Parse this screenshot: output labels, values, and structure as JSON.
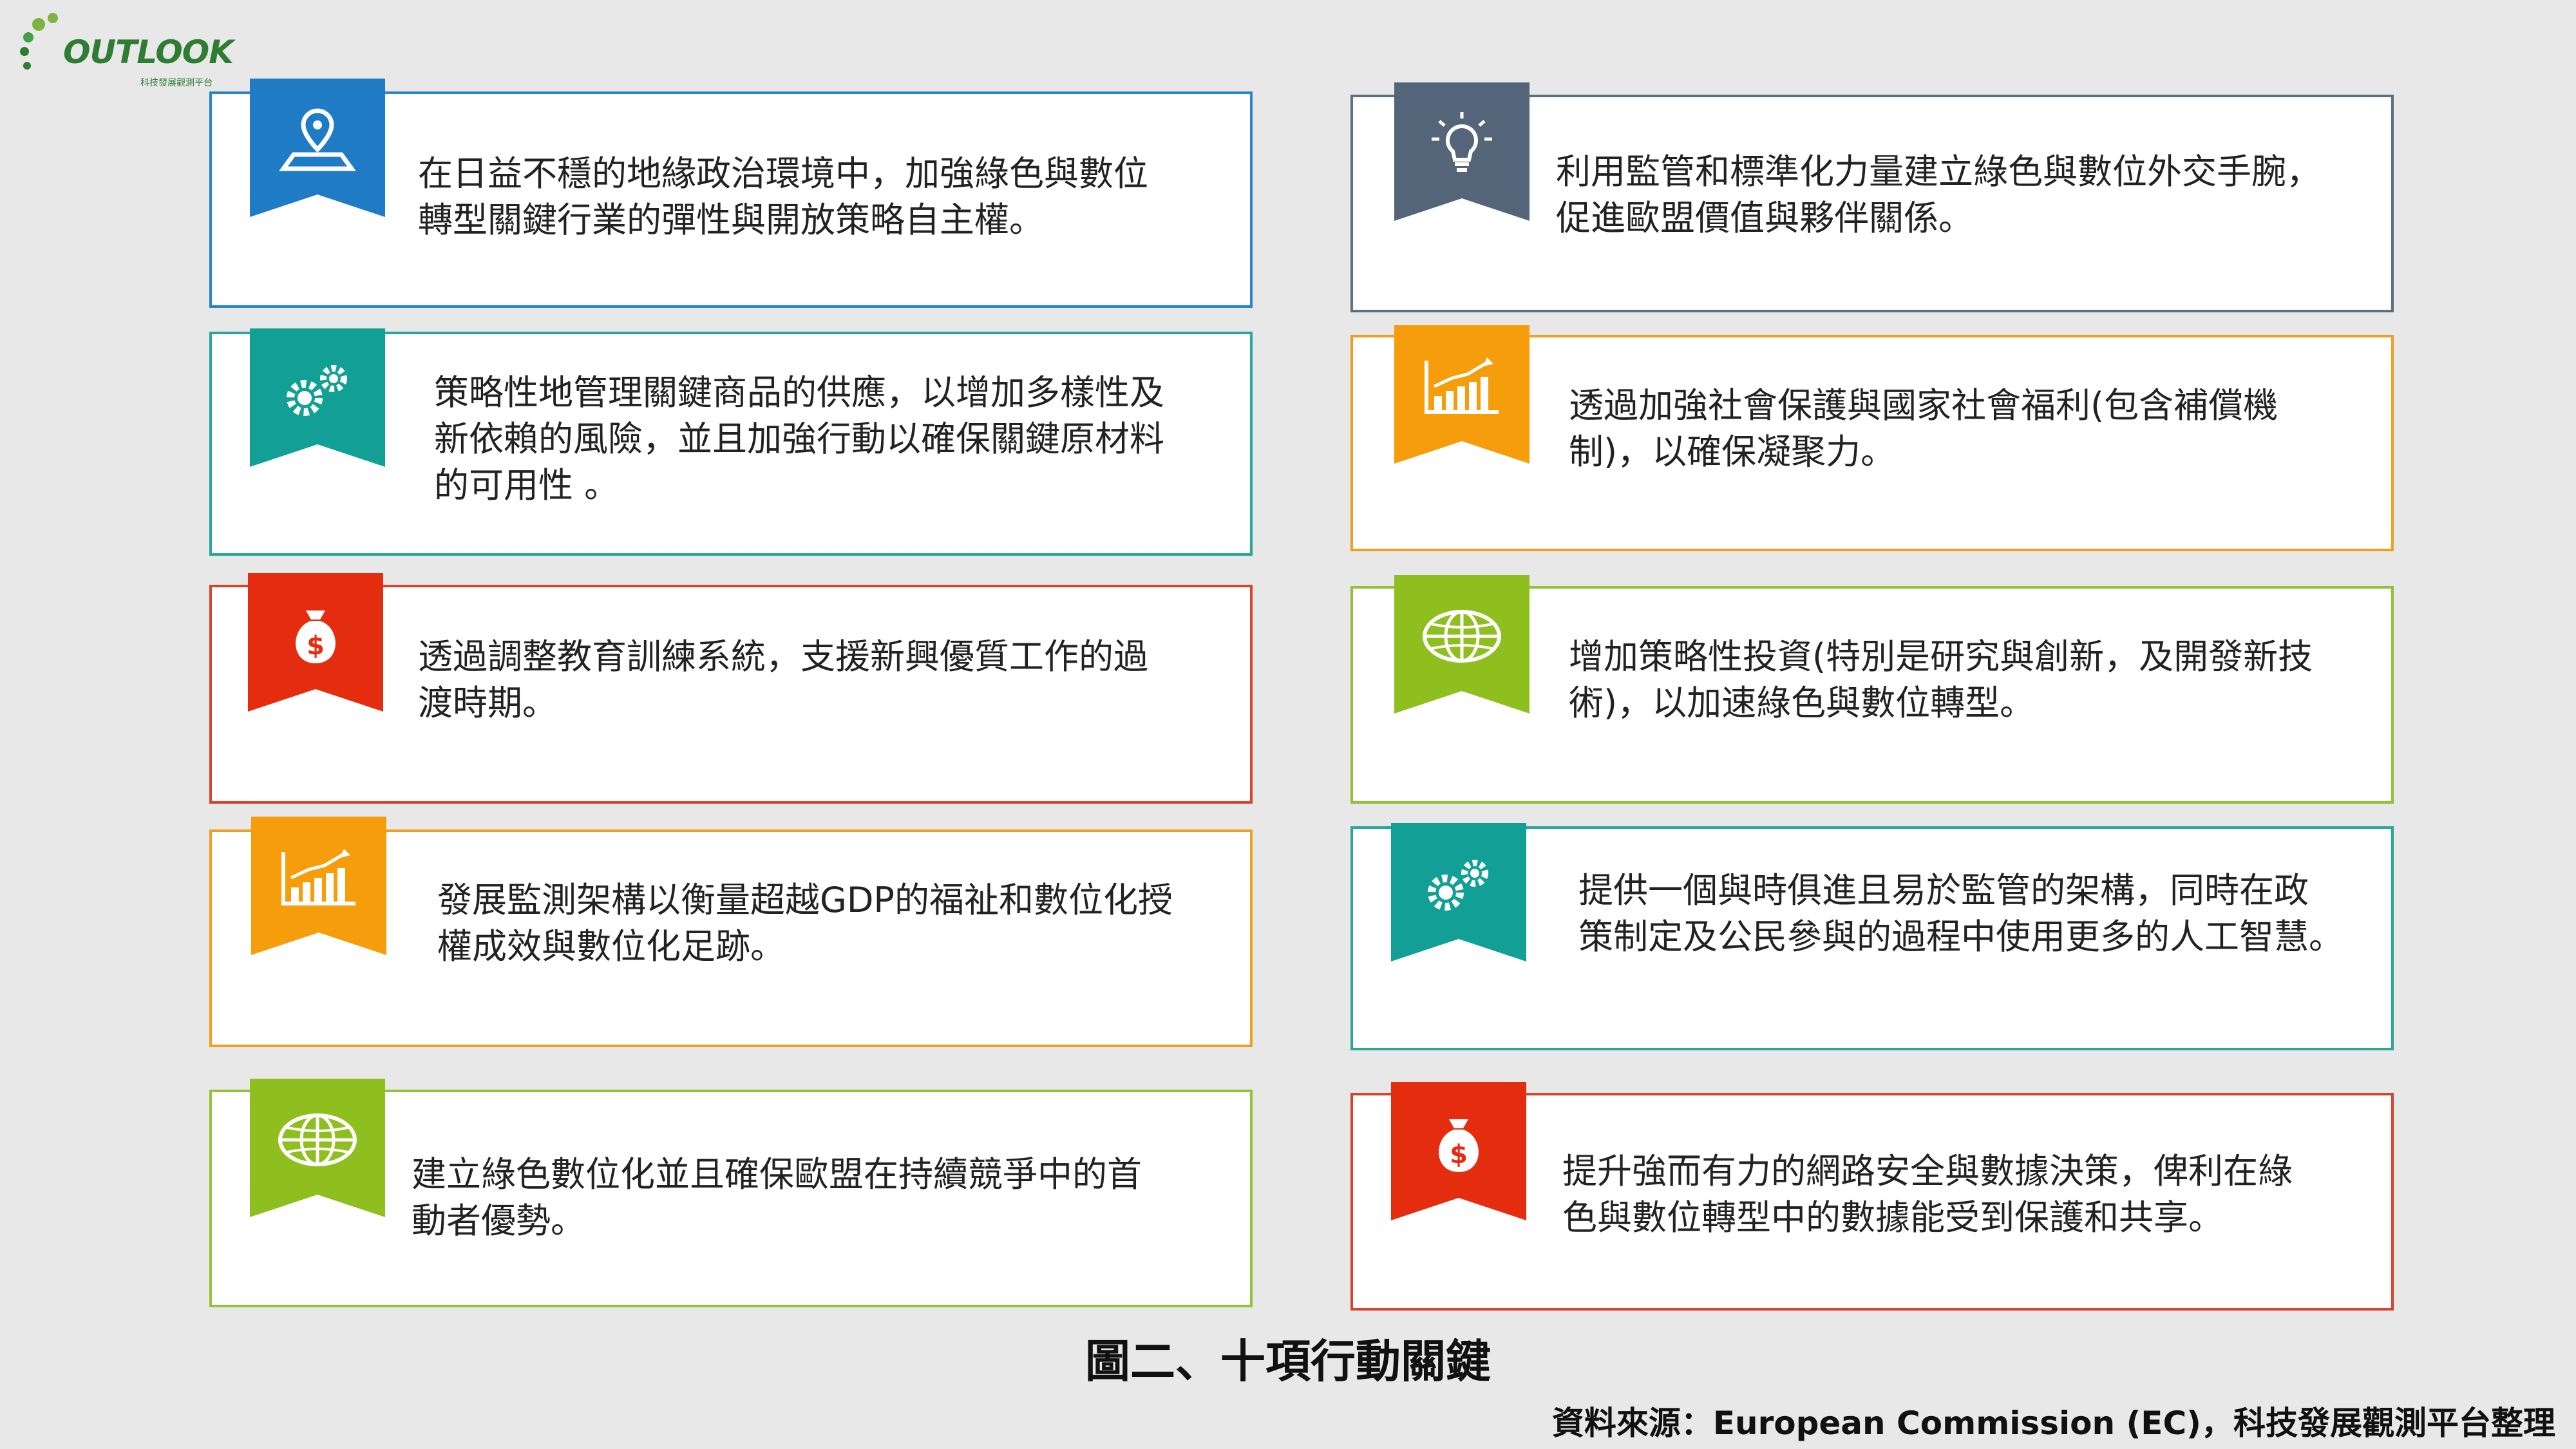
{
  "logo": {
    "name": "OUTLOOK",
    "subtitle": "科技發展觀測平台"
  },
  "colors": {
    "blue": "#1e7bc4",
    "slate": "#54657a",
    "teal": "#12a096",
    "orange": "#f59d0b",
    "red": "#e42c0e",
    "green": "#8ebf1e"
  },
  "cards": [
    {
      "icon": "map-pin-icon",
      "color": "#1e7bc4",
      "border": "#2b84c6",
      "text": "在日益不穩的地緣政治環境中，加強綠色與數位\n轉型關鍵行業的彈性與開放策略自主權。"
    },
    {
      "icon": "gears-icon",
      "color": "#12a096",
      "border": "#2aa79d",
      "text": "策略性地管理關鍵商品的供應，以增加多樣性及\n新依賴的風險，並且加強行動以確保關鍵原材料\n的可用性 。"
    },
    {
      "icon": "money-bag-icon",
      "color": "#e42c0e",
      "border": "#d6452d",
      "text": "透過調整教育訓練系統，支援新興優質工作的過\n渡時期。"
    },
    {
      "icon": "bar-chart-icon",
      "color": "#f59d0b",
      "border": "#f0a020",
      "text": "發展監測架構以衡量超越GDP的福祉和數位化授\n權成效與數位化足跡。"
    },
    {
      "icon": "globe-icon",
      "color": "#8ebf1e",
      "border": "#95c136",
      "text": "建立綠色數位化並且確保歐盟在持續競爭中的首\n動者優勢。"
    },
    {
      "icon": "lightbulb-icon",
      "color": "#54657a",
      "border": "#5d6f85",
      "text": "利用監管和標準化力量建立綠色與數位外交手腕，\n促進歐盟價值與夥伴關係。"
    },
    {
      "icon": "bar-chart-icon",
      "color": "#f59d0b",
      "border": "#f0a020",
      "text": "透過加強社會保護與國家社會福利(包含補償機\n制)，以確保凝聚力。"
    },
    {
      "icon": "globe-icon",
      "color": "#8ebf1e",
      "border": "#95c136",
      "text": "增加策略性投資(特別是研究與創新，及開發新技\n術)，以加速綠色與數位轉型。"
    },
    {
      "icon": "gears-icon",
      "color": "#12a096",
      "border": "#2aa79d",
      "text": "提供一個與時俱進且易於監管的架構，同時在政\n策制定及公民參與的過程中使用更多的人工智慧。"
    },
    {
      "icon": "money-bag-icon",
      "color": "#e42c0e",
      "border": "#d6452d",
      "text": "提升強而有力的網路安全與數據決策，俾利在綠\n色與數位轉型中的數據能受到保護和共享。"
    }
  ],
  "caption": "圖二、十項行動關鍵",
  "source": "資料來源：European Commission (EC)，科技發展觀測平台整理"
}
